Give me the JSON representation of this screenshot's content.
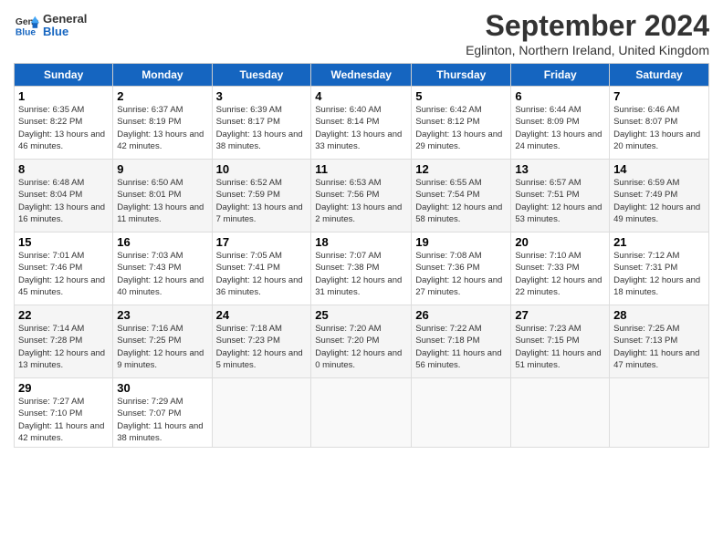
{
  "header": {
    "logo_line1": "General",
    "logo_line2": "Blue",
    "title": "September 2024",
    "subtitle": "Eglinton, Northern Ireland, United Kingdom"
  },
  "columns": [
    "Sunday",
    "Monday",
    "Tuesday",
    "Wednesday",
    "Thursday",
    "Friday",
    "Saturday"
  ],
  "weeks": [
    [
      {
        "day": "1",
        "sunrise": "Sunrise: 6:35 AM",
        "sunset": "Sunset: 8:22 PM",
        "daylight": "Daylight: 13 hours and 46 minutes."
      },
      {
        "day": "2",
        "sunrise": "Sunrise: 6:37 AM",
        "sunset": "Sunset: 8:19 PM",
        "daylight": "Daylight: 13 hours and 42 minutes."
      },
      {
        "day": "3",
        "sunrise": "Sunrise: 6:39 AM",
        "sunset": "Sunset: 8:17 PM",
        "daylight": "Daylight: 13 hours and 38 minutes."
      },
      {
        "day": "4",
        "sunrise": "Sunrise: 6:40 AM",
        "sunset": "Sunset: 8:14 PM",
        "daylight": "Daylight: 13 hours and 33 minutes."
      },
      {
        "day": "5",
        "sunrise": "Sunrise: 6:42 AM",
        "sunset": "Sunset: 8:12 PM",
        "daylight": "Daylight: 13 hours and 29 minutes."
      },
      {
        "day": "6",
        "sunrise": "Sunrise: 6:44 AM",
        "sunset": "Sunset: 8:09 PM",
        "daylight": "Daylight: 13 hours and 24 minutes."
      },
      {
        "day": "7",
        "sunrise": "Sunrise: 6:46 AM",
        "sunset": "Sunset: 8:07 PM",
        "daylight": "Daylight: 13 hours and 20 minutes."
      }
    ],
    [
      {
        "day": "8",
        "sunrise": "Sunrise: 6:48 AM",
        "sunset": "Sunset: 8:04 PM",
        "daylight": "Daylight: 13 hours and 16 minutes."
      },
      {
        "day": "9",
        "sunrise": "Sunrise: 6:50 AM",
        "sunset": "Sunset: 8:01 PM",
        "daylight": "Daylight: 13 hours and 11 minutes."
      },
      {
        "day": "10",
        "sunrise": "Sunrise: 6:52 AM",
        "sunset": "Sunset: 7:59 PM",
        "daylight": "Daylight: 13 hours and 7 minutes."
      },
      {
        "day": "11",
        "sunrise": "Sunrise: 6:53 AM",
        "sunset": "Sunset: 7:56 PM",
        "daylight": "Daylight: 13 hours and 2 minutes."
      },
      {
        "day": "12",
        "sunrise": "Sunrise: 6:55 AM",
        "sunset": "Sunset: 7:54 PM",
        "daylight": "Daylight: 12 hours and 58 minutes."
      },
      {
        "day": "13",
        "sunrise": "Sunrise: 6:57 AM",
        "sunset": "Sunset: 7:51 PM",
        "daylight": "Daylight: 12 hours and 53 minutes."
      },
      {
        "day": "14",
        "sunrise": "Sunrise: 6:59 AM",
        "sunset": "Sunset: 7:49 PM",
        "daylight": "Daylight: 12 hours and 49 minutes."
      }
    ],
    [
      {
        "day": "15",
        "sunrise": "Sunrise: 7:01 AM",
        "sunset": "Sunset: 7:46 PM",
        "daylight": "Daylight: 12 hours and 45 minutes."
      },
      {
        "day": "16",
        "sunrise": "Sunrise: 7:03 AM",
        "sunset": "Sunset: 7:43 PM",
        "daylight": "Daylight: 12 hours and 40 minutes."
      },
      {
        "day": "17",
        "sunrise": "Sunrise: 7:05 AM",
        "sunset": "Sunset: 7:41 PM",
        "daylight": "Daylight: 12 hours and 36 minutes."
      },
      {
        "day": "18",
        "sunrise": "Sunrise: 7:07 AM",
        "sunset": "Sunset: 7:38 PM",
        "daylight": "Daylight: 12 hours and 31 minutes."
      },
      {
        "day": "19",
        "sunrise": "Sunrise: 7:08 AM",
        "sunset": "Sunset: 7:36 PM",
        "daylight": "Daylight: 12 hours and 27 minutes."
      },
      {
        "day": "20",
        "sunrise": "Sunrise: 7:10 AM",
        "sunset": "Sunset: 7:33 PM",
        "daylight": "Daylight: 12 hours and 22 minutes."
      },
      {
        "day": "21",
        "sunrise": "Sunrise: 7:12 AM",
        "sunset": "Sunset: 7:31 PM",
        "daylight": "Daylight: 12 hours and 18 minutes."
      }
    ],
    [
      {
        "day": "22",
        "sunrise": "Sunrise: 7:14 AM",
        "sunset": "Sunset: 7:28 PM",
        "daylight": "Daylight: 12 hours and 13 minutes."
      },
      {
        "day": "23",
        "sunrise": "Sunrise: 7:16 AM",
        "sunset": "Sunset: 7:25 PM",
        "daylight": "Daylight: 12 hours and 9 minutes."
      },
      {
        "day": "24",
        "sunrise": "Sunrise: 7:18 AM",
        "sunset": "Sunset: 7:23 PM",
        "daylight": "Daylight: 12 hours and 5 minutes."
      },
      {
        "day": "25",
        "sunrise": "Sunrise: 7:20 AM",
        "sunset": "Sunset: 7:20 PM",
        "daylight": "Daylight: 12 hours and 0 minutes."
      },
      {
        "day": "26",
        "sunrise": "Sunrise: 7:22 AM",
        "sunset": "Sunset: 7:18 PM",
        "daylight": "Daylight: 11 hours and 56 minutes."
      },
      {
        "day": "27",
        "sunrise": "Sunrise: 7:23 AM",
        "sunset": "Sunset: 7:15 PM",
        "daylight": "Daylight: 11 hours and 51 minutes."
      },
      {
        "day": "28",
        "sunrise": "Sunrise: 7:25 AM",
        "sunset": "Sunset: 7:13 PM",
        "daylight": "Daylight: 11 hours and 47 minutes."
      }
    ],
    [
      {
        "day": "29",
        "sunrise": "Sunrise: 7:27 AM",
        "sunset": "Sunset: 7:10 PM",
        "daylight": "Daylight: 11 hours and 42 minutes."
      },
      {
        "day": "30",
        "sunrise": "Sunrise: 7:29 AM",
        "sunset": "Sunset: 7:07 PM",
        "daylight": "Daylight: 11 hours and 38 minutes."
      },
      {
        "day": "",
        "sunrise": "",
        "sunset": "",
        "daylight": ""
      },
      {
        "day": "",
        "sunrise": "",
        "sunset": "",
        "daylight": ""
      },
      {
        "day": "",
        "sunrise": "",
        "sunset": "",
        "daylight": ""
      },
      {
        "day": "",
        "sunrise": "",
        "sunset": "",
        "daylight": ""
      },
      {
        "day": "",
        "sunrise": "",
        "sunset": "",
        "daylight": ""
      }
    ]
  ]
}
